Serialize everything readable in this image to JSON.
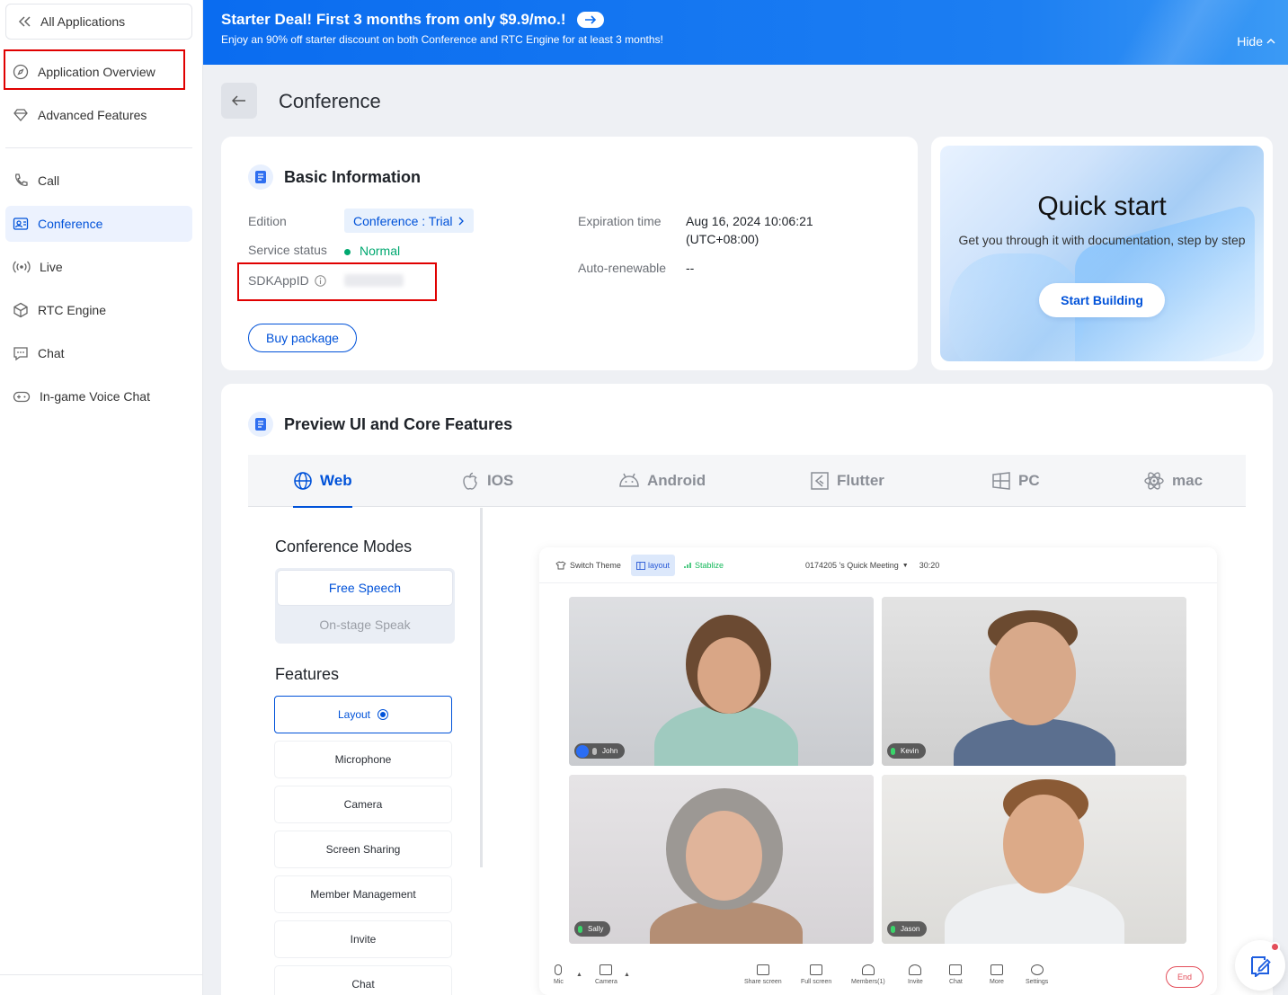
{
  "sidebar": {
    "back_label": "All Applications",
    "items": [
      {
        "label": "Application Overview",
        "icon": "compass-icon"
      },
      {
        "label": "Advanced Features",
        "icon": "diamond-icon"
      },
      {
        "label": "Call",
        "icon": "phone-icon"
      },
      {
        "label": "Conference",
        "icon": "conference-icon",
        "active": true
      },
      {
        "label": "Live",
        "icon": "broadcast-icon"
      },
      {
        "label": "RTC Engine",
        "icon": "cube-icon"
      },
      {
        "label": "Chat",
        "icon": "chat-icon"
      },
      {
        "label": "In-game Voice Chat",
        "icon": "gamepad-icon"
      }
    ]
  },
  "banner": {
    "title": "Starter Deal! First 3 months from only $9.9/mo.!",
    "subtitle": "Enjoy an 90% off starter discount on both Conference and RTC Engine for at least 3 months!",
    "hide_label": "Hide"
  },
  "page": {
    "title": "Conference"
  },
  "basic_info": {
    "title": "Basic Information",
    "edition_label": "Edition",
    "edition_value": "Conference : Trial",
    "status_label": "Service status",
    "status_value": "Normal",
    "sdkappid_label": "SDKAppID",
    "sdkappid_value": "",
    "expiration_label": "Expiration time",
    "expiration_value_line1": "Aug 16, 2024 10:06:21",
    "expiration_value_line2": "(UTC+08:00)",
    "autorenew_label": "Auto-renewable",
    "autorenew_value": "--",
    "buy_label": "Buy package"
  },
  "quick_start": {
    "title": "Quick start",
    "subtitle": "Get you through it with documentation, step by step",
    "button": "Start Building"
  },
  "preview": {
    "title": "Preview UI and Core Features",
    "tabs": [
      "Web",
      "IOS",
      "Android",
      "Flutter",
      "PC",
      "mac"
    ],
    "active_tab": "Web",
    "modes_heading": "Conference Modes",
    "modes": [
      "Free Speech",
      "On-stage Speak"
    ],
    "features_heading": "Features",
    "features": [
      "Layout",
      "Microphone",
      "Camera",
      "Screen Sharing",
      "Member Management",
      "Invite",
      "Chat"
    ],
    "meeting": {
      "switch_theme": "Switch Theme",
      "layout": "layout",
      "stabilize": "Stablize",
      "meeting_title": "0174205 's Quick Meeting",
      "timer": "30:20",
      "participants": [
        "John",
        "Kevin",
        "Sally",
        "Jason"
      ],
      "controls_left": [
        "Mic",
        "Camera"
      ],
      "controls_center": [
        "Share screen",
        "Full screen",
        "Members(1)",
        "Invite",
        "Chat",
        "More",
        "Settings"
      ],
      "end_label": "End"
    }
  },
  "colors": {
    "accent": "#0052d9",
    "banner": "#0a6cf0",
    "status_green": "#00a870",
    "highlight": "#e00000"
  }
}
